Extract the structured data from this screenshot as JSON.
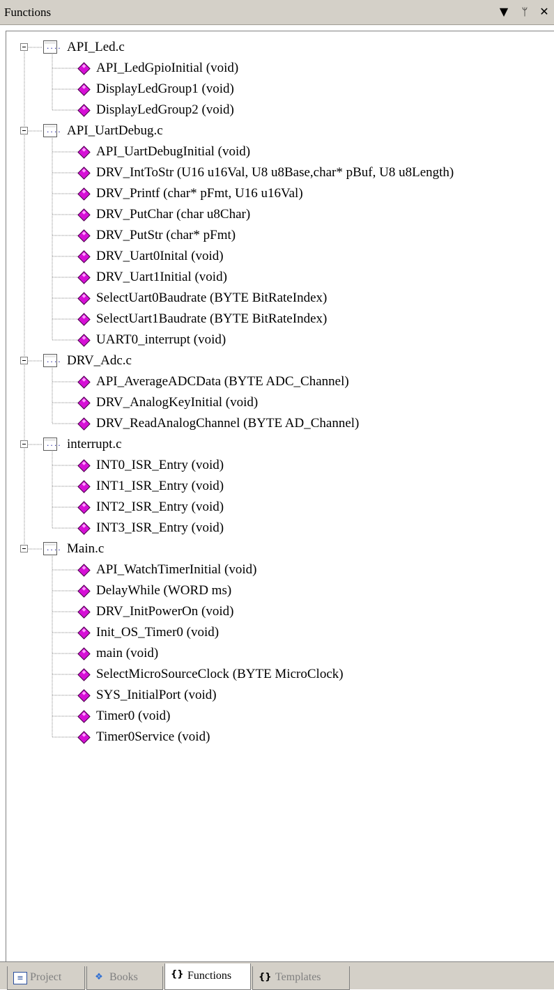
{
  "window": {
    "title": "Functions",
    "buttons": {
      "dropdown": "▼",
      "pin": "ᛘ",
      "close": "✕"
    }
  },
  "tree": [
    {
      "file": "API_Led.c",
      "functions": [
        "API_LedGpioInitial (void)",
        "DisplayLedGroup1 (void)",
        "DisplayLedGroup2 (void)"
      ]
    },
    {
      "file": "API_UartDebug.c",
      "functions": [
        "API_UartDebugInitial (void)",
        "DRV_IntToStr (U16 u16Val, U8 u8Base,char* pBuf, U8 u8Length)",
        "DRV_Printf (char* pFmt, U16 u16Val)",
        "DRV_PutChar (char u8Char)",
        "DRV_PutStr (char* pFmt)",
        "DRV_Uart0Inital (void)",
        "DRV_Uart1Initial (void)",
        "SelectUart0Baudrate (BYTE BitRateIndex)",
        "SelectUart1Baudrate (BYTE BitRateIndex)",
        "UART0_interrupt (void)"
      ]
    },
    {
      "file": "DRV_Adc.c",
      "functions": [
        "API_AverageADCData (BYTE ADC_Channel)",
        "DRV_AnalogKeyInitial (void)",
        "DRV_ReadAnalogChannel (BYTE AD_Channel)"
      ]
    },
    {
      "file": "interrupt.c",
      "functions": [
        "INT0_ISR_Entry (void)",
        "INT1_ISR_Entry (void)",
        "INT2_ISR_Entry (void)",
        "INT3_ISR_Entry (void)"
      ]
    },
    {
      "file": "Main.c",
      "functions": [
        "API_WatchTimerInitial (void)",
        "DelayWhile (WORD ms)",
        "DRV_InitPowerOn (void)",
        "Init_OS_Timer0 (void)",
        "main (void)",
        "SelectMicroSourceClock (BYTE MicroClock)",
        "SYS_InitialPort (void)",
        "Timer0 (void)",
        "Timer0Service (void)"
      ]
    }
  ],
  "tabs": [
    {
      "label": "Project",
      "icon": "project-icon",
      "active": false
    },
    {
      "label": "Books",
      "icon": "books-icon",
      "active": false
    },
    {
      "label": "Functions",
      "icon": "braces-icon",
      "active": true
    },
    {
      "label": "Templates",
      "icon": "templates-icon",
      "active": false
    }
  ],
  "colors": {
    "function_icon": "#d60fd6",
    "chrome": "#d4d0c8"
  }
}
